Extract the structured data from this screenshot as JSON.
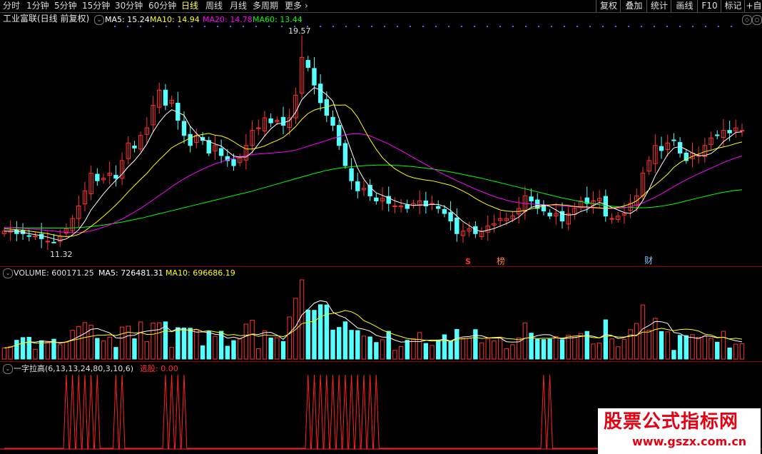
{
  "period_tabs": [
    {
      "label": "分时",
      "active": false
    },
    {
      "label": "1分钟",
      "active": false
    },
    {
      "label": "5分钟",
      "active": false
    },
    {
      "label": "15分钟",
      "active": false
    },
    {
      "label": "30分钟",
      "active": false
    },
    {
      "label": "60分钟",
      "active": false
    },
    {
      "label": "日线",
      "active": true
    },
    {
      "label": "周线",
      "active": false
    },
    {
      "label": "月线",
      "active": false
    },
    {
      "label": "多周期",
      "active": false
    },
    {
      "label": "更多",
      "active": false
    }
  ],
  "more_arrow": "›",
  "right_buttons": [
    "复权",
    "叠加",
    "统计",
    "画线",
    "F10",
    "标记",
    "+自"
  ],
  "main_pane": {
    "title": "工业富联(日线 前复权)",
    "ma": [
      {
        "label": "MA5: 15.24",
        "color": "#ffffff"
      },
      {
        "label": "MA10: 14.94",
        "color": "#ffff00"
      },
      {
        "label": "MA20: 14.78",
        "color": "#ff00ff"
      },
      {
        "label": "MA60: 13.44",
        "color": "#00ff00"
      }
    ],
    "high_label": "19.57",
    "low_label": "11.32",
    "signals": [
      {
        "label": "S",
        "color": "#ff3030"
      },
      {
        "label": "榜",
        "color": "#ff8040"
      },
      {
        "label": "财",
        "color": "#80c0ff"
      }
    ]
  },
  "volume_pane": {
    "label": "VOLUME: 600171.25",
    "ma5": "MA5: 726481.31",
    "ma10": "MA10: 696686.19"
  },
  "indicator_pane": {
    "name": "一字拉高(6,13,13,24,80,3,10,6)",
    "select_label": "选股: 0.00"
  },
  "watermark": {
    "title": "股票公式指标网",
    "url": "www.gszx.com.cn"
  },
  "colors": {
    "up": "#ff3232",
    "down": "#54ffff",
    "ma5": "#ffffff",
    "ma10": "#ffff00",
    "ma20": "#ff00ff",
    "ma60": "#00ff00",
    "grid": "#8b0000"
  },
  "chart_data": {
    "type": "candlestick",
    "price_range": [
      11.32,
      19.57
    ],
    "closes": [
      11.8,
      11.8,
      11.7,
      11.7,
      11.6,
      11.6,
      11.5,
      11.4,
      11.35,
      11.6,
      11.9,
      12.3,
      12.8,
      13.4,
      14.1,
      13.8,
      13.9,
      14.1,
      13.9,
      14.6,
      15.3,
      15.1,
      15.6,
      15.9,
      16.8,
      17.4,
      16.8,
      17.0,
      16.2,
      15.6,
      15.2,
      15.6,
      15.4,
      14.9,
      15.2,
      14.8,
      14.6,
      14.4,
      14.7,
      15.2,
      15.8,
      15.9,
      16.3,
      16.1,
      16.2,
      16.0,
      16.3,
      17.2,
      18.7,
      18.3,
      17.6,
      16.9,
      16.4,
      16.0,
      15.2,
      14.4,
      13.8,
      13.4,
      13.5,
      13.2,
      13.0,
      13.1,
      12.9,
      12.8,
      12.8,
      12.7,
      12.9,
      13.0,
      12.8,
      12.9,
      12.7,
      12.5,
      12.2,
      11.7,
      11.8,
      11.9,
      11.7,
      11.8,
      12.0,
      12.1,
      12.3,
      12.3,
      12.4,
      12.7,
      13.2,
      13.0,
      12.7,
      12.6,
      12.4,
      12.5,
      12.2,
      12.5,
      12.7,
      13.0,
      12.9,
      13.0,
      13.1,
      12.4,
      12.3,
      12.4,
      12.5,
      12.9,
      13.2,
      14.1,
      14.6,
      15.2,
      15.0,
      15.3,
      15.4,
      14.9,
      14.6,
      14.9,
      14.8,
      15.2,
      15.5,
      15.6,
      15.8,
      15.7,
      15.9,
      15.8
    ],
    "ma5": [
      11.8,
      11.8,
      11.8,
      11.75,
      11.7,
      11.66,
      11.62,
      11.56,
      11.49,
      11.43,
      11.49,
      11.65,
      11.86,
      12.2,
      12.64,
      12.96,
      13.28,
      13.56,
      13.82,
      14.06,
      14.36,
      14.6,
      14.9,
      15.26,
      15.74,
      16.12,
      16.42,
      16.62,
      16.52,
      16.4,
      15.96,
      15.68,
      15.44,
      15.36,
      15.26,
      15.18,
      14.98,
      14.78,
      14.74,
      14.74,
      14.94,
      15.26,
      15.58,
      15.86,
      16.06,
      16.1,
      16.18,
      16.52,
      17.02,
      17.28,
      17.5,
      17.4,
      17.22,
      16.96,
      16.28,
      15.66,
      14.96,
      14.3,
      13.86,
      13.54,
      13.32,
      13.22,
      13.12,
      13.0,
      12.92,
      12.86,
      12.82,
      12.84,
      12.84,
      12.86,
      12.86,
      12.78,
      12.62,
      12.4,
      12.18,
      12.02,
      11.86,
      11.78,
      11.84,
      11.9,
      12.0,
      12.1,
      12.22,
      12.36,
      12.58,
      12.74,
      12.82,
      12.84,
      12.78,
      12.64,
      12.48,
      12.44,
      12.46,
      12.58,
      12.66,
      12.82,
      12.94,
      12.86,
      12.74,
      12.64,
      12.54,
      12.5,
      12.66,
      13.02,
      13.46,
      14.0,
      14.42,
      14.84,
      15.1,
      15.16,
      15.04,
      14.9,
      14.8,
      14.8,
      14.88,
      15.07,
      15.35,
      15.53,
      15.72,
      15.74
    ],
    "ma10": [
      11.9,
      11.88,
      11.86,
      11.84,
      11.8,
      11.77,
      11.74,
      11.7,
      11.65,
      11.6,
      11.58,
      11.6,
      11.67,
      11.81,
      11.99,
      12.18,
      12.39,
      12.61,
      12.84,
      13.09,
      13.36,
      13.61,
      13.86,
      14.09,
      14.38,
      14.63,
      14.87,
      15.11,
      15.25,
      15.37,
      15.5,
      15.59,
      15.64,
      15.68,
      15.61,
      15.58,
      15.49,
      15.35,
      15.19,
      15.06,
      15.06,
      15.11,
      15.18,
      15.3,
      15.4,
      15.52,
      15.72,
      15.95,
      16.24,
      16.47,
      16.61,
      16.68,
      16.73,
      16.81,
      16.8,
      16.81,
      16.64,
      16.32,
      15.87,
      15.43,
      15.05,
      14.72,
      14.48,
      14.28,
      14.13,
      14.0,
      13.92,
      13.87,
      13.83,
      13.8,
      13.74,
      13.68,
      13.62,
      13.51,
      13.39,
      13.26,
      13.1,
      12.96,
      12.84,
      12.74,
      12.64,
      12.6,
      12.58,
      12.58,
      12.62,
      12.68,
      12.74,
      12.8,
      12.84,
      12.86,
      12.84,
      12.82,
      12.78,
      12.76,
      12.76,
      12.74,
      12.72,
      12.7,
      12.72,
      12.74,
      12.8,
      12.88,
      13.0,
      13.21,
      13.45,
      13.64,
      13.84,
      14.06,
      14.33,
      14.52,
      14.66,
      14.77,
      14.86,
      14.96,
      15.01,
      15.09,
      15.14,
      15.2,
      15.28,
      15.34
    ],
    "ma20": [
      11.95,
      11.94,
      11.92,
      11.91,
      11.89,
      11.87,
      11.85,
      11.83,
      11.8,
      11.77,
      11.75,
      11.74,
      11.74,
      11.76,
      11.81,
      11.88,
      11.96,
      12.05,
      12.16,
      12.28,
      12.42,
      12.56,
      12.71,
      12.87,
      13.04,
      13.21,
      13.38,
      13.56,
      13.73,
      13.88,
      14.02,
      14.14,
      14.26,
      14.37,
      14.47,
      14.55,
      14.63,
      14.7,
      14.75,
      14.8,
      14.84,
      14.86,
      14.88,
      14.9,
      14.92,
      14.94,
      14.97,
      15.02,
      15.09,
      15.17,
      15.25,
      15.32,
      15.4,
      15.48,
      15.55,
      15.62,
      15.66,
      15.67,
      15.64,
      15.58,
      15.48,
      15.37,
      15.26,
      15.13,
      15.0,
      14.86,
      14.72,
      14.58,
      14.44,
      14.3,
      14.17,
      14.04,
      13.92,
      13.8,
      13.69,
      13.58,
      13.47,
      13.37,
      13.27,
      13.18,
      13.1,
      13.03,
      12.97,
      12.93,
      12.9,
      12.88,
      12.86,
      12.85,
      12.84,
      12.82,
      12.8,
      12.78,
      12.76,
      12.74,
      12.73,
      12.72,
      12.71,
      12.7,
      12.7,
      12.71,
      12.73,
      12.77,
      12.83,
      12.92,
      13.03,
      13.15,
      13.28,
      13.42,
      13.57,
      13.71,
      13.84,
      13.96,
      14.08,
      14.19,
      14.3,
      14.41,
      14.52,
      14.62,
      14.71,
      14.78
    ],
    "ma60": [
      11.95,
      11.94,
      11.94,
      11.93,
      11.93,
      11.92,
      11.92,
      11.92,
      11.92,
      11.92,
      11.92,
      11.93,
      11.94,
      11.96,
      11.98,
      12.01,
      12.04,
      12.08,
      12.12,
      12.16,
      12.21,
      12.26,
      12.31,
      12.37,
      12.43,
      12.49,
      12.55,
      12.61,
      12.67,
      12.73,
      12.79,
      12.85,
      12.91,
      12.97,
      13.03,
      13.09,
      13.15,
      13.21,
      13.27,
      13.33,
      13.39,
      13.46,
      13.53,
      13.6,
      13.67,
      13.74,
      13.81,
      13.88,
      13.95,
      14.02,
      14.09,
      14.15,
      14.21,
      14.26,
      14.3,
      14.33,
      14.36,
      14.38,
      14.4,
      14.41,
      14.42,
      14.42,
      14.42,
      14.41,
      14.4,
      14.38,
      14.36,
      14.33,
      14.3,
      14.27,
      14.23,
      14.19,
      14.15,
      14.1,
      14.05,
      14.0,
      13.95,
      13.9,
      13.84,
      13.78,
      13.72,
      13.66,
      13.6,
      13.54,
      13.48,
      13.42,
      13.36,
      13.3,
      13.24,
      13.18,
      13.12,
      13.07,
      13.02,
      12.97,
      12.93,
      12.89,
      12.85,
      12.82,
      12.79,
      12.77,
      12.75,
      12.74,
      12.73,
      12.73,
      12.74,
      12.76,
      12.79,
      12.83,
      12.88,
      12.94,
      13.0,
      13.06,
      13.12,
      13.18,
      13.24,
      13.29,
      13.34,
      13.38,
      13.42,
      13.44
    ],
    "indicator_spikes": [
      10,
      11,
      12,
      13,
      14,
      15,
      18,
      19,
      26,
      27,
      28,
      29,
      49,
      50,
      51,
      52,
      53,
      54,
      55,
      56,
      57,
      58,
      59,
      60,
      87,
      88
    ]
  }
}
